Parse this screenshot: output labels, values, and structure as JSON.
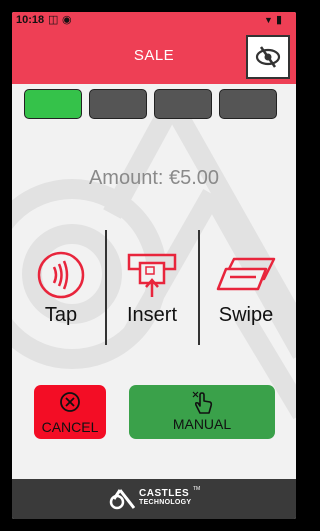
{
  "status_bar": {
    "time": "10:18"
  },
  "header": {
    "title": "SALE"
  },
  "progress": {
    "total_steps": 4,
    "active_step": 1
  },
  "amount": {
    "text": "Amount: €5.00"
  },
  "methods": [
    {
      "label": "Tap",
      "icon": "contactless-icon"
    },
    {
      "label": "Insert",
      "icon": "card-insert-icon"
    },
    {
      "label": "Swipe",
      "icon": "card-swipe-icon"
    }
  ],
  "actions": {
    "cancel_label": "CANCEL",
    "manual_label": "MANUAL"
  },
  "footer": {
    "brand_name": "CASTLES",
    "brand_tm": "TM",
    "brand_sub": "TECHNOLOGY"
  },
  "colors": {
    "header": "#ee3f55",
    "accent_red": "#e8253c",
    "step_active": "#35c24a",
    "step_inactive": "#555555",
    "cancel": "#f30d25",
    "manual": "#3aa14a",
    "footer": "#3a3a3a"
  }
}
